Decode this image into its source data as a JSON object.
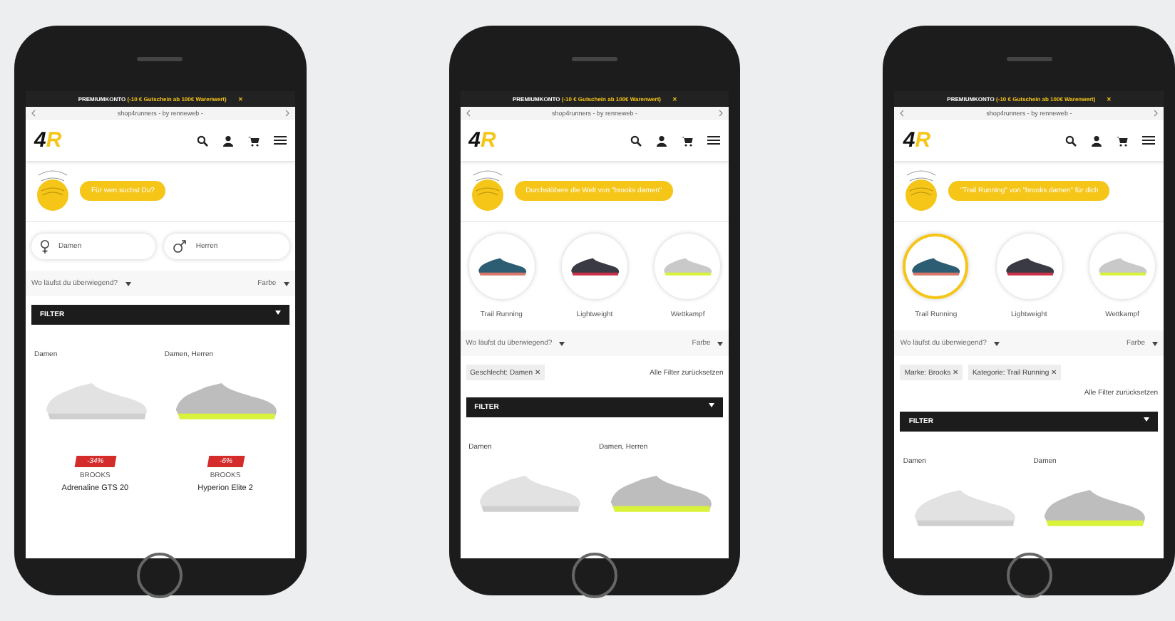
{
  "phones": [
    {
      "banner": {
        "text": "PREMIUMKONTO",
        "highlight": "(-10 € Gutschein ab 100€ Warenwert)",
        "close": "✕"
      },
      "url": "shop4runners - by renneweb -",
      "logo": "4R",
      "bubble": "Für wen suchst Du?",
      "genders": [
        {
          "kind": "female",
          "label": "Damen"
        },
        {
          "kind": "male",
          "label": "Herren"
        }
      ],
      "sort_label": "Wo läufst du überwiegend?",
      "color_label": "Farbe",
      "filter_label": "FILTER",
      "products": [
        {
          "gender": "Damen",
          "discount": "-34%",
          "brand": "BROOKS",
          "name": "Adrenaline GTS 20"
        },
        {
          "gender": "Damen, Herren",
          "discount": "-6%",
          "brand": "BROOKS",
          "name": "Hyperion Elite 2"
        }
      ]
    },
    {
      "banner": {
        "text": "PREMIUMKONTO",
        "highlight": "(-10 € Gutschein ab 100€ Warenwert)",
        "close": "✕"
      },
      "url": "shop4runners - by renneweb -",
      "logo": "4R",
      "bubble": "Durchstöbere die Welt von \"brooks damen\"",
      "categories": [
        {
          "label": "Trail Running",
          "selected": false
        },
        {
          "label": "Lightweight",
          "selected": false
        },
        {
          "label": "Wettkampf",
          "selected": false
        }
      ],
      "sort_label": "Wo läufst du überwiegend?",
      "color_label": "Farbe",
      "chips": [
        {
          "label": "Geschlecht: Damen ✕"
        }
      ],
      "reset": "Alle Filter zurücksetzen",
      "filter_label": "FILTER",
      "products": [
        {
          "gender": "Damen"
        },
        {
          "gender": "Damen, Herren"
        }
      ]
    },
    {
      "banner": {
        "text": "PREMIUMKONTO",
        "highlight": "(-10 € Gutschein ab 100€ Warenwert)",
        "close": "✕"
      },
      "url": "shop4runners - by renneweb -",
      "logo": "4R",
      "bubble": "\"Trail Running\" von \"brooks damen\" für dich",
      "categories": [
        {
          "label": "Trail Running",
          "selected": true
        },
        {
          "label": "Lightweight",
          "selected": false
        },
        {
          "label": "Wettkampf",
          "selected": false
        }
      ],
      "sort_label": "Wo läufst du überwiegend?",
      "color_label": "Farbe",
      "chips": [
        {
          "label": "Marke: Brooks ✕"
        },
        {
          "label": "Kategorie: Trail Running ✕"
        }
      ],
      "reset": "Alle Filter zurücksetzen",
      "filter_label": "FILTER",
      "products": [
        {
          "gender": "Damen"
        },
        {
          "gender": "Damen"
        }
      ]
    }
  ]
}
